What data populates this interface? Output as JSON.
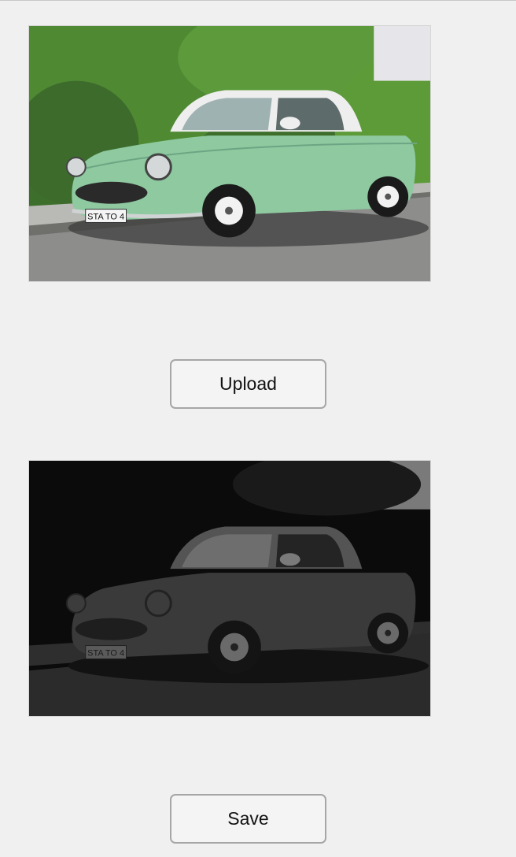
{
  "buttons": {
    "upload_label": "Upload",
    "save_label": "Save"
  },
  "images": {
    "original": {
      "license_plate": "STA TO 4",
      "car_color": "#8ec9a0",
      "roof_color": "#eeeeee"
    },
    "processed": {
      "license_plate": "STA TO 4",
      "tone": "darkened grayscale"
    }
  }
}
